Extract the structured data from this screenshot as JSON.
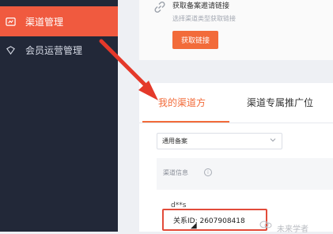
{
  "sidebar": {
    "items": [
      {
        "label": "渠道管理",
        "icon": "channel-icon",
        "active": true
      },
      {
        "label": "会员运营管理",
        "icon": "member-icon",
        "active": false
      }
    ]
  },
  "link_card": {
    "title": "获取备案邀请链接",
    "subtitle": "选择渠道类型获取链接",
    "button_label": "获取链接"
  },
  "tabs": [
    "我的渠道方",
    "渠道专属推广位"
  ],
  "filter": {
    "value": "通用备案"
  },
  "info": {
    "title": "渠道信息",
    "icon": "info-icon"
  },
  "account": {
    "name": "d**s",
    "relation_id": "关系ID: 2607908418"
  },
  "watermark": "未来学者",
  "colors": {
    "accent": "#f26b3a",
    "sidebar_bg": "#222838",
    "highlight": "#e24b3a"
  }
}
